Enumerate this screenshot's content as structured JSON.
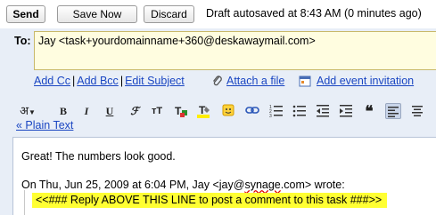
{
  "toolbar_top": {
    "send_label": "Send",
    "save_label": "Save Now",
    "discard_label": "Discard",
    "autosave_status": "Draft autosaved at 8:43 AM (0 minutes ago)"
  },
  "recipients": {
    "to_label": "To:",
    "to_value": "Jay <task+yourdomainname+360@deskawaymail.com>"
  },
  "compose_links": {
    "add_cc": "Add Cc",
    "add_bcc": "Add Bcc",
    "edit_subject": "Edit Subject",
    "attach_file": "Attach a file",
    "add_event": "Add event invitation",
    "separator": "|"
  },
  "formatting": {
    "font_label": "अ",
    "plain_text_link": "« Plain Text"
  },
  "body": {
    "greeting": "Great! The numbers look good.",
    "quote_header_prefix": "On Thu, Jun 25, 2009 at 6:04 PM, Jay <jay@",
    "quote_header_domain": "synage",
    "quote_header_suffix": ".com> wrote:",
    "reply_marker": "<<### Reply ABOVE THIS LINE to post a comment to this task ###>>"
  },
  "colors": {
    "compose_bg": "#e8eef7",
    "link": "#1a46c2",
    "to_field_bg": "#fffde0",
    "highlight": "#ffff33"
  },
  "icons": [
    "paperclip-icon",
    "calendar-icon",
    "bold-icon",
    "italic-icon",
    "underline-icon",
    "font-icon",
    "text-size-icon",
    "text-color-icon",
    "highlight-icon",
    "emoticon-icon",
    "link-icon",
    "numbered-list-icon",
    "bulleted-list-icon",
    "indent-less-icon",
    "indent-more-icon",
    "quote-icon",
    "align-left-icon",
    "align-center-icon"
  ]
}
